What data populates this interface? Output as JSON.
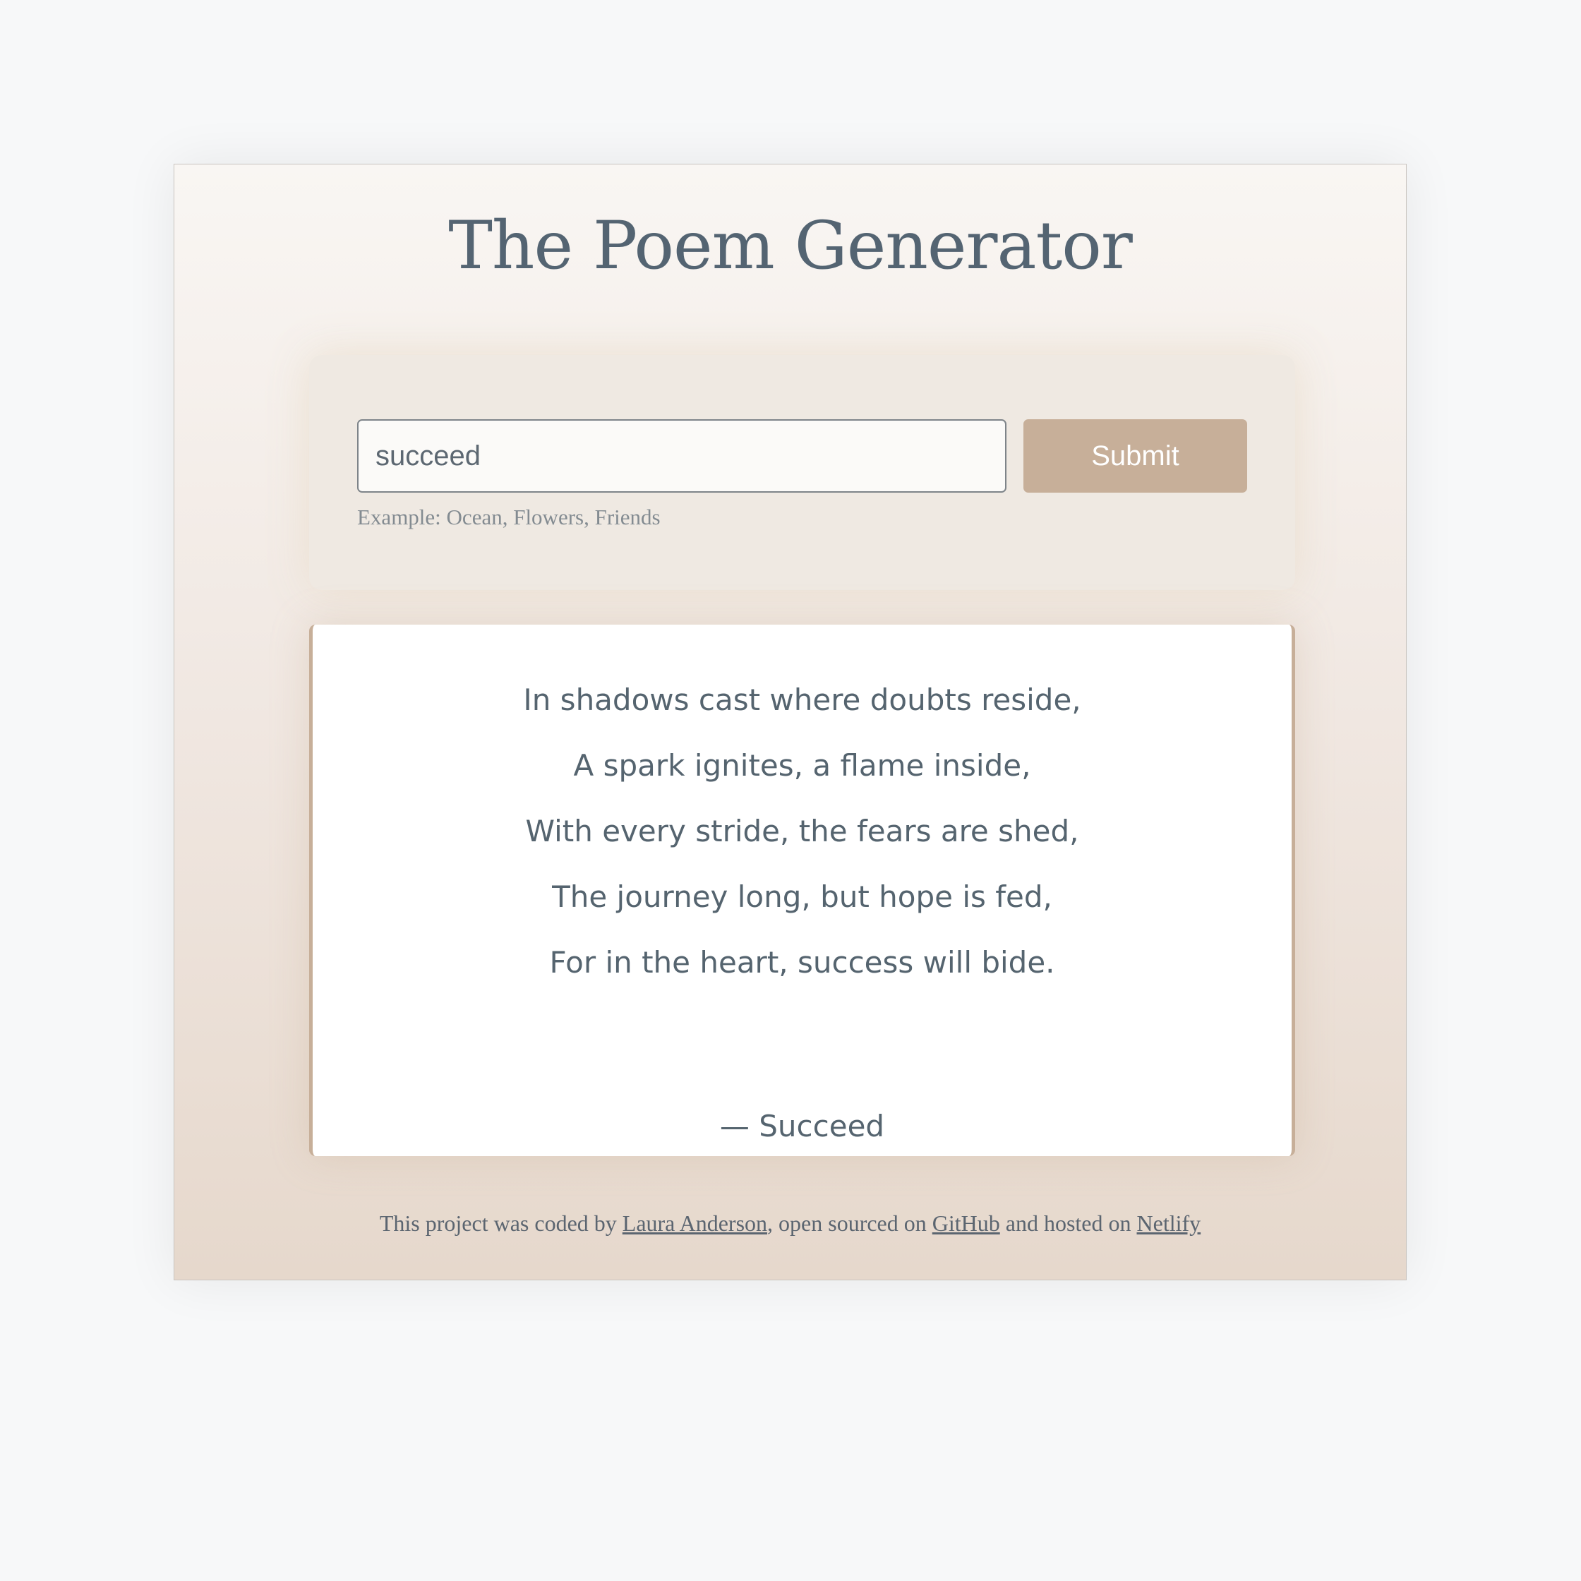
{
  "app": {
    "title": "The Poem Generator"
  },
  "search": {
    "value": "succeed",
    "submit_label": "Submit",
    "hint": "Example: Ocean, Flowers, Friends"
  },
  "poem": {
    "lines": [
      "In shadows cast where doubts reside,",
      "A spark ignites, a flame inside,",
      "With every stride, the fears are shed,",
      "The journey long, but hope is fed,",
      "For in the heart, success will bide."
    ],
    "signature": "— Succeed"
  },
  "footer": {
    "text_1": "This project was coded by ",
    "author_link": "Laura Anderson",
    "text_2": ", open sourced on ",
    "github_link": "GitHub",
    "text_3": " and hosted on ",
    "netlify_link": "Netlify"
  },
  "colors": {
    "page_background": "#f7f8f9",
    "title_text": "#546472",
    "submit_button": "#c7af99",
    "poem_border": "#c7af99",
    "card_gradient_top": "#f9f6f3",
    "card_gradient_bottom": "#e6d8cc"
  }
}
